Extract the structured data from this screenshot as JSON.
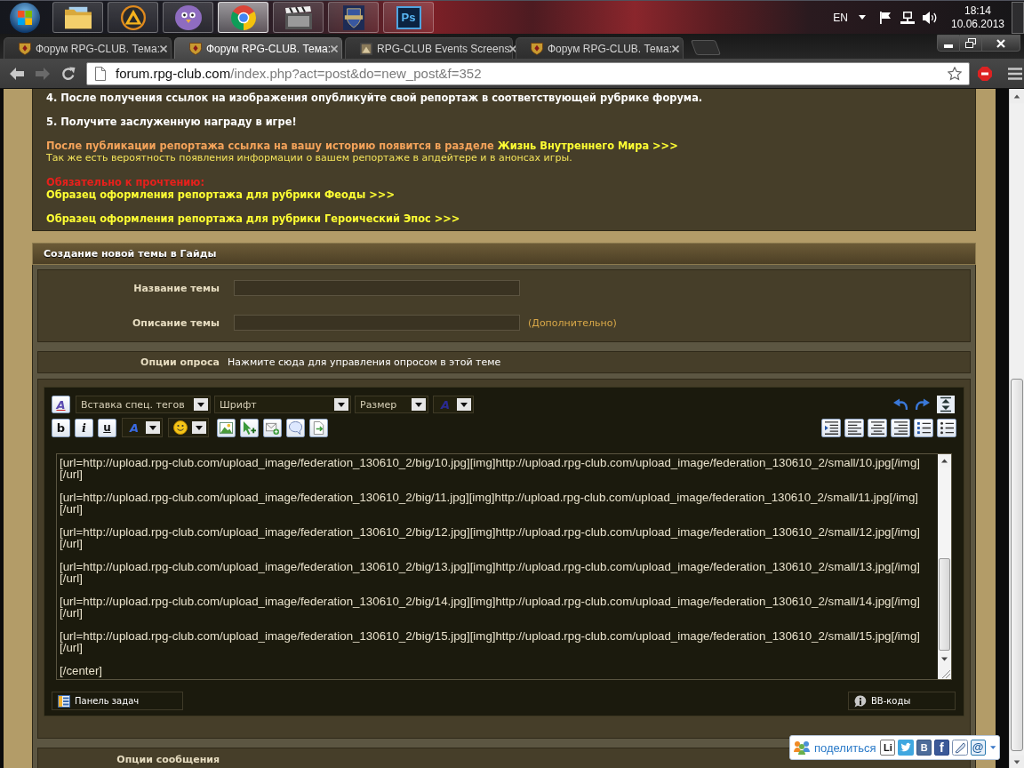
{
  "taskbar": {
    "apps": [
      {
        "kind": "folder",
        "selected": false
      },
      {
        "kind": "player",
        "selected": false
      },
      {
        "kind": "messenger",
        "selected": false
      },
      {
        "kind": "browser",
        "selected": true
      },
      {
        "kind": "video",
        "selected": false
      },
      {
        "kind": "game",
        "selected": false
      },
      {
        "kind": "editor",
        "label": "Ps",
        "selected": false
      }
    ],
    "tray": {
      "language": "EN",
      "time": "18:14",
      "date": "10.06.2013"
    }
  },
  "browser": {
    "tabs": [
      {
        "kind": "crest",
        "title": "Форум RPG-CLUB. Тема:",
        "selected": false
      },
      {
        "kind": "crest",
        "title": "Форум RPG-CLUB. Тема:",
        "selected": true
      },
      {
        "kind": "tile",
        "title": "RPG-CLUB Events Screens",
        "selected": false
      },
      {
        "kind": "crest",
        "title": "Форум RPG-CLUB. Тема:",
        "selected": false
      }
    ],
    "forward": {
      "disabled": true
    },
    "address": {
      "host": "forum.rpg-club.com",
      "path": "/index.php?act=post&do=new_post&f=352"
    }
  },
  "announcement": {
    "paragraphs": [
      [
        {
          "kind": "step",
          "text": "4. После получения ссылок на изображения опубликуйте свой репортаж в соответствующей рубрике форума."
        }
      ],
      [
        {
          "kind": "step",
          "text": "5. Получите заслуженную награду в игре!"
        }
      ],
      [
        {
          "kind": "notice",
          "text": "После публикации репортажа ссылка на вашу историю появится в разделе",
          "link": "Жизнь Внутреннего Мира >>>"
        },
        {
          "kind": "note",
          "text": "Так же есть вероятность появления информации о вашем репортаже в апдейтере и в анонсах игры."
        }
      ],
      [
        {
          "kind": "warning",
          "text": "Обязательно к прочтению:"
        },
        {
          "kind": "link",
          "text": "Образец оформления репортажа для рубрики Феоды >>>"
        },
        {
          "kind": "link",
          "text": "Образец оформления репортажа для рубрики Героический Эпос >>>"
        }
      ]
    ]
  },
  "new_topic_form": {
    "title": "Создание новой темы в Гайды",
    "fields": [
      {
        "label": "Название темы"
      },
      {
        "label": "Описание темы",
        "hint": "(Дополнительно)"
      }
    ],
    "poll": {
      "label": "Опции опроса",
      "link": "Нажмите сюда для управления опросом в этой теме"
    },
    "editor": {
      "style_toggle": "A",
      "selects": [
        "Вставка спец. тегов",
        "Шрифт",
        "Размер"
      ],
      "highlight_select": "A",
      "format_buttons": [
        {
          "kind": "bold",
          "label": "b"
        },
        {
          "kind": "italic",
          "label": "i"
        },
        {
          "kind": "underline",
          "label": "u"
        }
      ],
      "text_color_select": "A",
      "content": [
        [
          "[url=http://upload.rpg-club.com/upload_image/federation_130610_2/big/10.jpg][img]http://upload.rpg-club.com/upload_image/federation_130610_2/small/10.jpg[/img]",
          "[/url]"
        ],
        [
          "[url=http://upload.rpg-club.com/upload_image/federation_130610_2/big/11.jpg][img]http://upload.rpg-club.com/upload_image/federation_130610_2/small/11.jpg[/img]",
          "[/url]"
        ],
        [
          "[url=http://upload.rpg-club.com/upload_image/federation_130610_2/big/12.jpg][img]http://upload.rpg-club.com/upload_image/federation_130610_2/small/12.jpg[/img]",
          "[/url]"
        ],
        [
          "[url=http://upload.rpg-club.com/upload_image/federation_130610_2/big/13.jpg][img]http://upload.rpg-club.com/upload_image/federation_130610_2/small/13.jpg[/img]",
          "[/url]"
        ],
        [
          "[url=http://upload.rpg-club.com/upload_image/federation_130610_2/big/14.jpg][img]http://upload.rpg-club.com/upload_image/federation_130610_2/small/14.jpg[/img]",
          "[/url]"
        ],
        [
          "[url=http://upload.rpg-club.com/upload_image/federation_130610_2/big/15.jpg][img]http://upload.rpg-club.com/upload_image/federation_130610_2/small/15.jpg[/img]",
          "[/url]"
        ],
        [
          "[/center]"
        ]
      ],
      "footer_buttons": [
        {
          "kind": "panel",
          "label": "Панель задач"
        },
        {
          "kind": "help",
          "label": "BB-коды"
        }
      ]
    },
    "message_options": {
      "label": "Опции сообщения"
    }
  },
  "share": {
    "label": "поделиться",
    "services": [
      {
        "kind": "li",
        "label": "Li"
      },
      {
        "kind": "twitter"
      },
      {
        "kind": "vk",
        "label": "B"
      },
      {
        "kind": "facebook",
        "label": "f"
      },
      {
        "kind": "feather"
      },
      {
        "kind": "mail",
        "label": "@"
      }
    ]
  }
}
